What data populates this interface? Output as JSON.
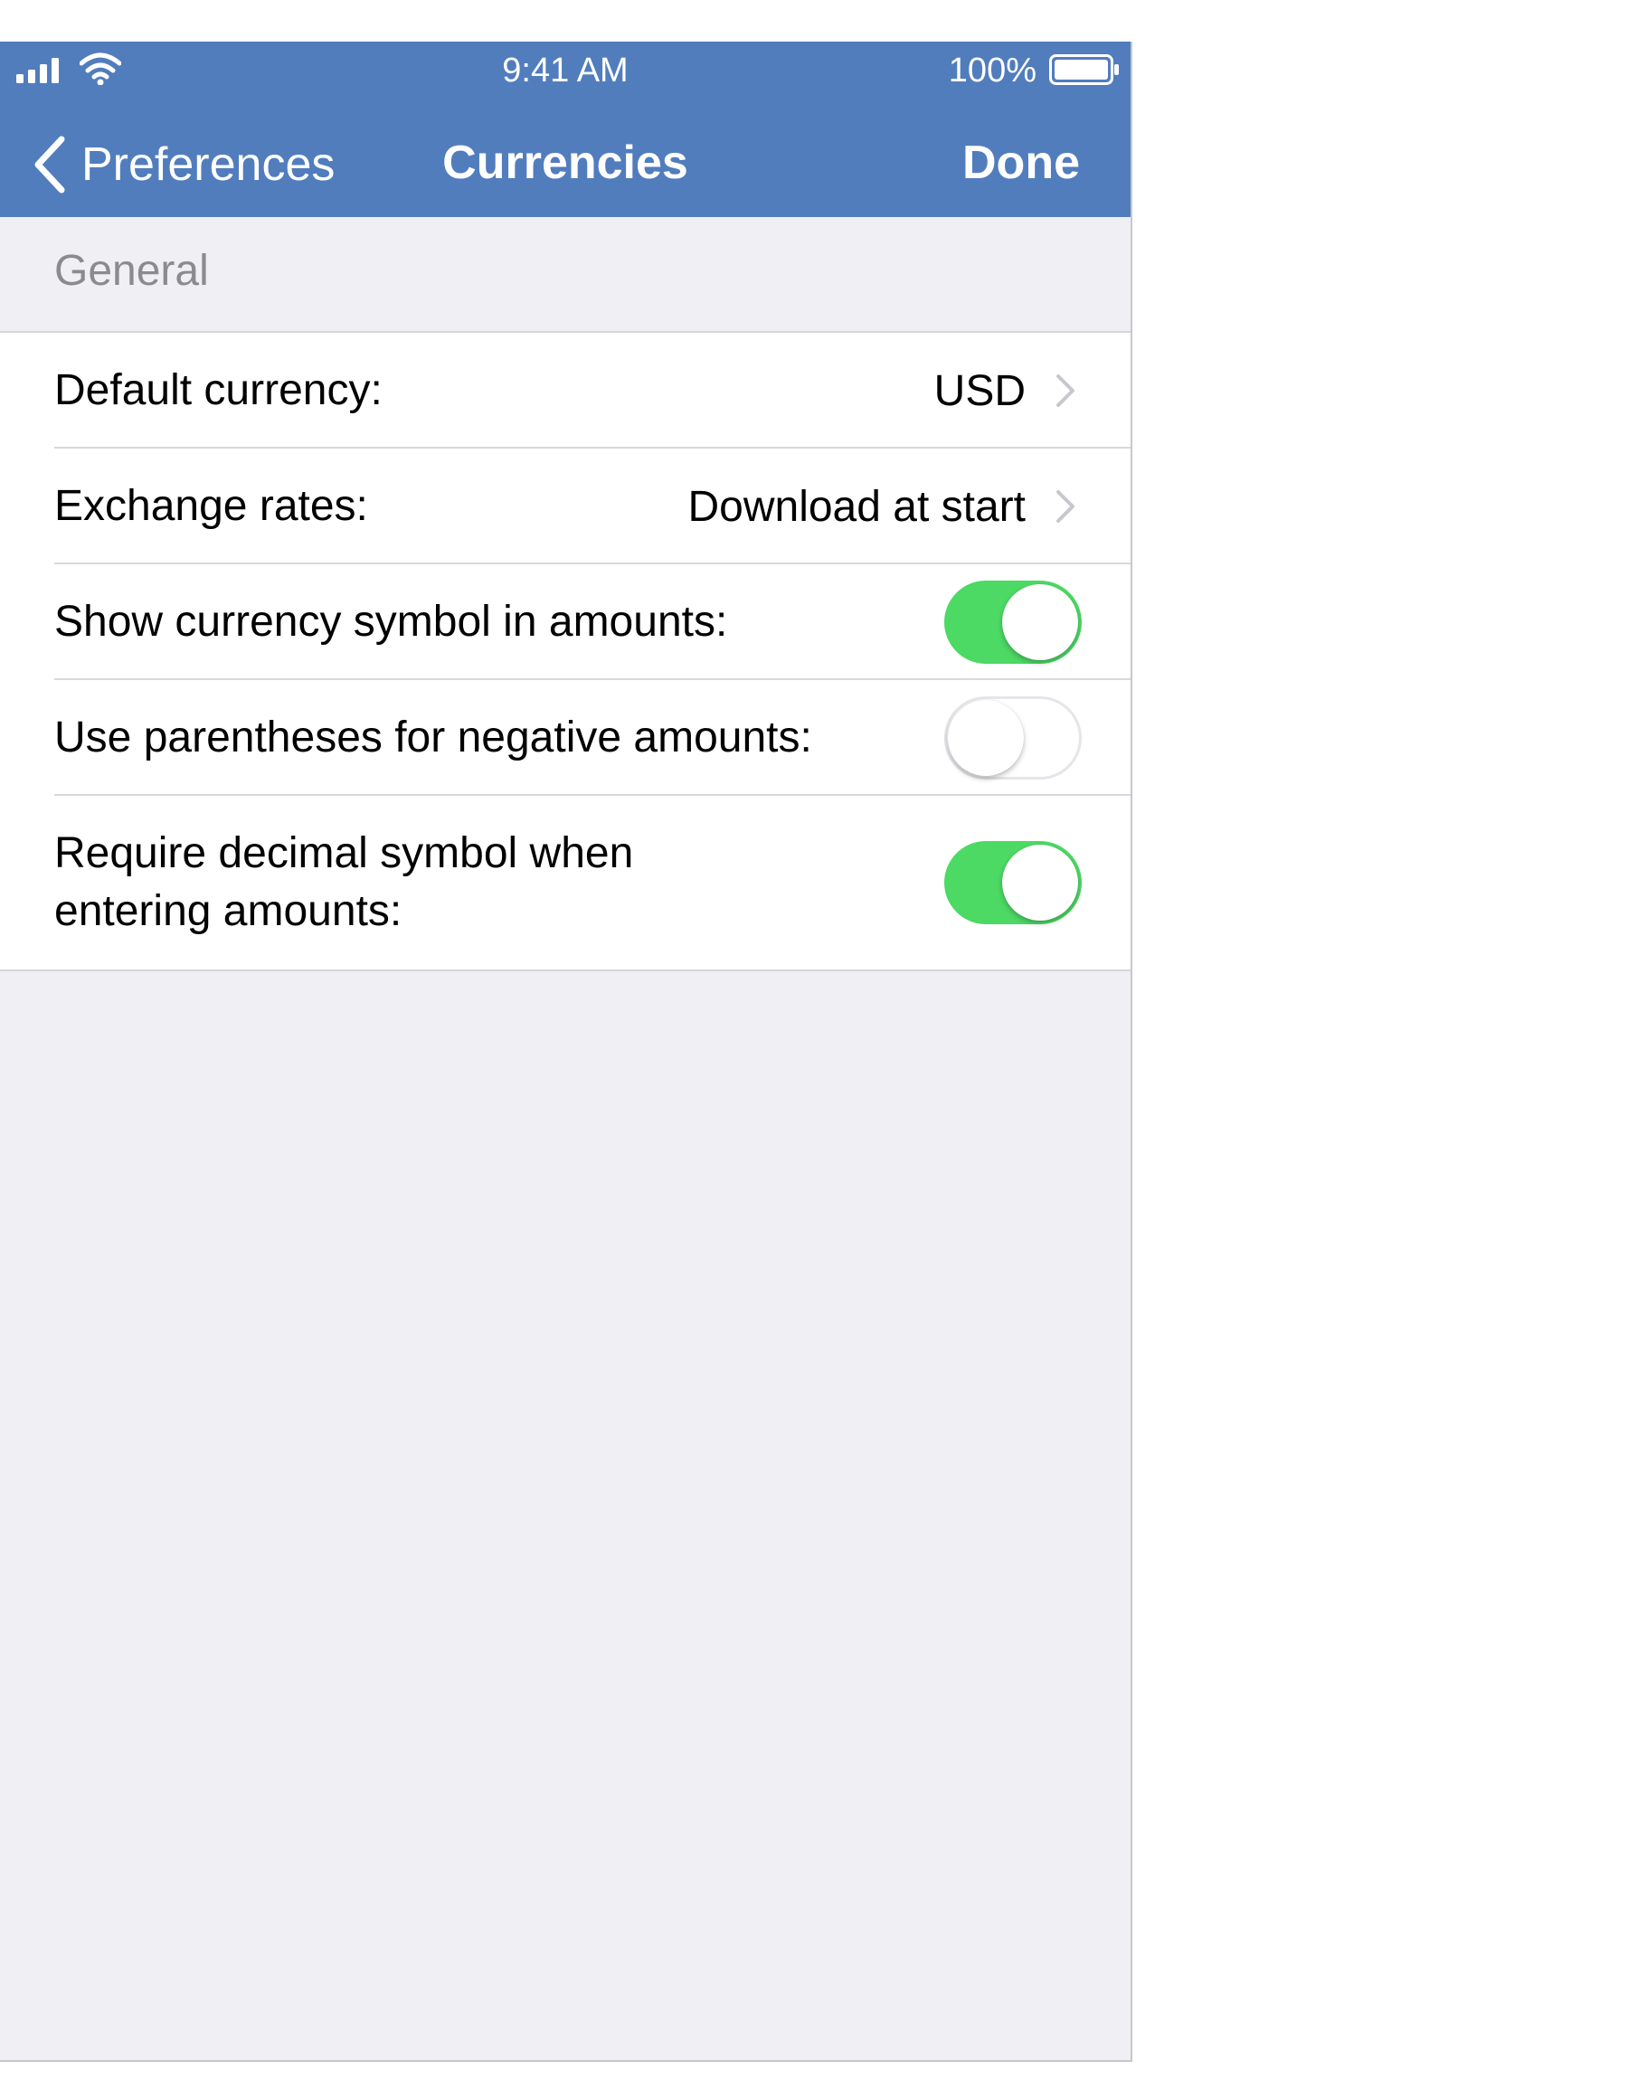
{
  "status_bar": {
    "time": "9:41 AM",
    "battery_percent": "100%"
  },
  "nav": {
    "back_label": "Preferences",
    "title": "Currencies",
    "done_label": "Done"
  },
  "colors": {
    "nav_bar": "#517dbd",
    "toggle_on": "#4cd964",
    "background": "#efeff4"
  },
  "section": {
    "header": "General",
    "rows": [
      {
        "label": "Default currency:",
        "value": "USD"
      },
      {
        "label": "Exchange rates:",
        "value": "Download at start"
      },
      {
        "label": "Show currency symbol in amounts:",
        "toggle_on": true
      },
      {
        "label": "Use parentheses for negative amounts:",
        "toggle_on": false
      },
      {
        "label": "Require decimal symbol when entering amounts:",
        "toggle_on": true
      }
    ]
  }
}
